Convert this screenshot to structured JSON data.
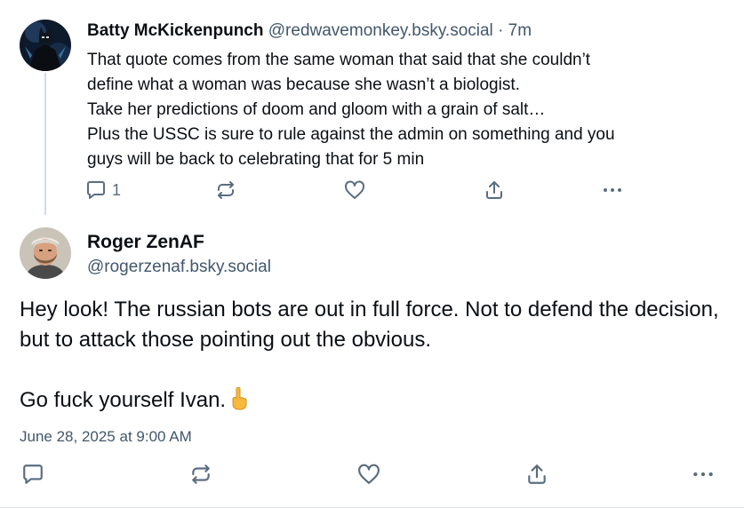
{
  "reply_post": {
    "author_name": "Batty McKickenpunch",
    "author_handle": "@redwavemonkey.bsky.social",
    "separator": "·",
    "time_ago": "7m",
    "text_lines": [
      "That quote comes from the same woman that said that she couldn’t",
      "define what a woman was because she wasn’t a biologist.",
      "Take her predictions of doom and gloom with a grain of salt…",
      "Plus the USSC is sure to rule against the admin on something and you",
      "guys will be back to celebrating that for 5 min"
    ],
    "reply_count": "1",
    "avatar_icon": "batman-avatar"
  },
  "main_post": {
    "author_name": "Roger ZenAF",
    "author_handle": "@rogerzenaf.bsky.social",
    "paragraph_1": "Hey look! The russian bots are out in full force. Not to defend the decision, but to attack those pointing out the obvious.",
    "paragraph_2": "Go fuck yourself Ivan.",
    "emoji_icon": "middle-finger-icon",
    "timestamp": "June 28, 2025 at 9:00 AM",
    "avatar_icon": "bearded-man-avatar"
  },
  "colors": {
    "text": "#0b0f14",
    "muted": "#42576c",
    "icon": "#5a6d80",
    "thread_line": "#d4dbe2",
    "emoji": "#f6b93b"
  },
  "icons": [
    "reply-icon",
    "repost-icon",
    "like-icon",
    "share-icon",
    "more-icon"
  ]
}
